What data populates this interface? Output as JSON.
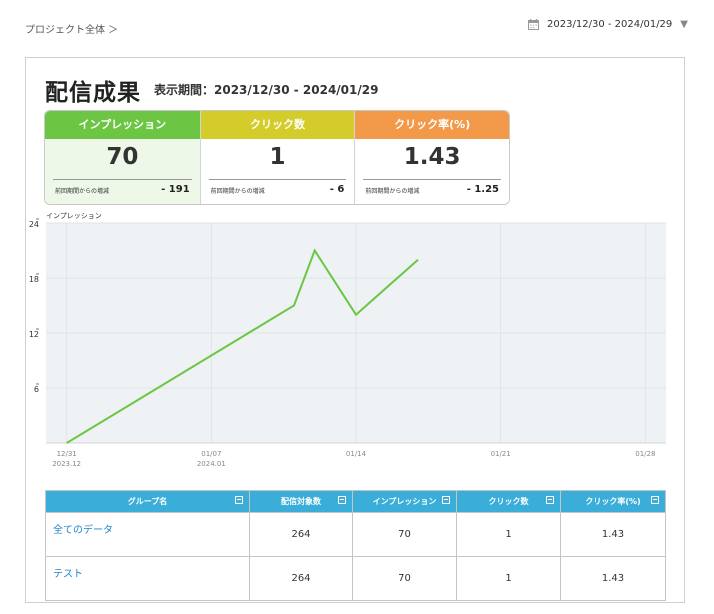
{
  "breadcrumb": "プロジェクト全体 ＞",
  "daterange": {
    "text": "2023/12/30 - 2024/01/29"
  },
  "panel": {
    "title": "配信成果",
    "period": "表示期間：2023/12/30 - 2024/01/29"
  },
  "kpis": [
    {
      "label": "インプレッション",
      "value": "70",
      "diff_label": "前回期間からの増減",
      "diff": "- 191",
      "color": "#6cc644",
      "bg": "#eef8e8"
    },
    {
      "label": "クリック数",
      "value": "1",
      "diff_label": "前回期間からの増減",
      "diff": "- 6",
      "color": "#d3cc2b",
      "bg": "#ffffff"
    },
    {
      "label": "クリック率(%)",
      "value": "1.43",
      "diff_label": "前回期間からの増減",
      "diff": "- 1.25",
      "color": "#f3994a",
      "bg": "#ffffff"
    }
  ],
  "chart_data": {
    "type": "line",
    "title": "インプレッション",
    "x_ticks": [
      {
        "date": "2023-12-31",
        "label": "12/31",
        "sub": "2023.12"
      },
      {
        "date": "2024-01-07",
        "label": "01/07",
        "sub": "2024.01"
      },
      {
        "date": "2024-01-14",
        "label": "01/14",
        "sub": ""
      },
      {
        "date": "2024-01-21",
        "label": "01/21",
        "sub": ""
      },
      {
        "date": "2024-01-28",
        "label": "01/28",
        "sub": ""
      }
    ],
    "y_ticks": [
      6,
      12,
      18,
      24
    ],
    "ylim": [
      0,
      24
    ],
    "xlim": [
      "2023-12-30",
      "2024-01-29"
    ],
    "series": [
      {
        "color": "#6cc644",
        "points": [
          {
            "x": "2023-12-31",
            "y": 0
          },
          {
            "x": "2024-01-11",
            "y": 15
          },
          {
            "x": "2024-01-12",
            "y": 21
          },
          {
            "x": "2024-01-14",
            "y": 14
          },
          {
            "x": "2024-01-17",
            "y": 20
          }
        ]
      }
    ],
    "grid": true
  },
  "table": {
    "headers": [
      "グループ名",
      "配信対象数",
      "インプレッション",
      "クリック数",
      "クリック率(%)"
    ],
    "rows": [
      [
        "全てのデータ",
        "264",
        "70",
        "1",
        "1.43"
      ],
      [
        "テスト",
        "264",
        "70",
        "1",
        "1.43"
      ]
    ]
  }
}
